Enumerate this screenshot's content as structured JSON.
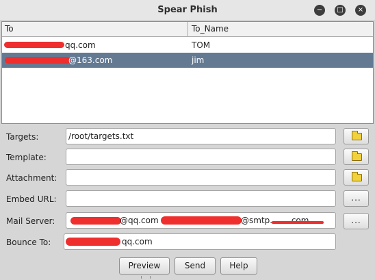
{
  "window": {
    "title": "Spear Phish",
    "controls": [
      "minimize-icon",
      "maximize-icon",
      "close-icon"
    ]
  },
  "table": {
    "columns": [
      "To",
      "To_Name"
    ],
    "rows": [
      {
        "to": "qq.com",
        "to_name": "TOM",
        "selected": false
      },
      {
        "to": "@163.com",
        "to_name": "jim",
        "selected": true
      }
    ]
  },
  "form": {
    "targets": {
      "label": "Targets:",
      "value": "/root/targets.txt",
      "button_icon": "folder-icon"
    },
    "template": {
      "label": "Template:",
      "value": "",
      "button_icon": "folder-icon"
    },
    "attachment": {
      "label": "Attachment:",
      "value": "",
      "button_icon": "folder-icon"
    },
    "embed_url": {
      "label": "Embed URL:",
      "value": "",
      "button_label": "..."
    },
    "mail_server": {
      "label": "Mail Server:",
      "value_part1": "@qq.com",
      "value_part2": "@smtp.",
      "value_part3": ".com",
      "button_label": "..."
    },
    "bounce_to": {
      "label": "Bounce To:",
      "value": "qq.com"
    }
  },
  "buttons": {
    "preview": "Preview",
    "send": "Send",
    "help": "Help"
  },
  "colors": {
    "selected_row": "#647a93",
    "redaction": "#ef2e2e"
  }
}
